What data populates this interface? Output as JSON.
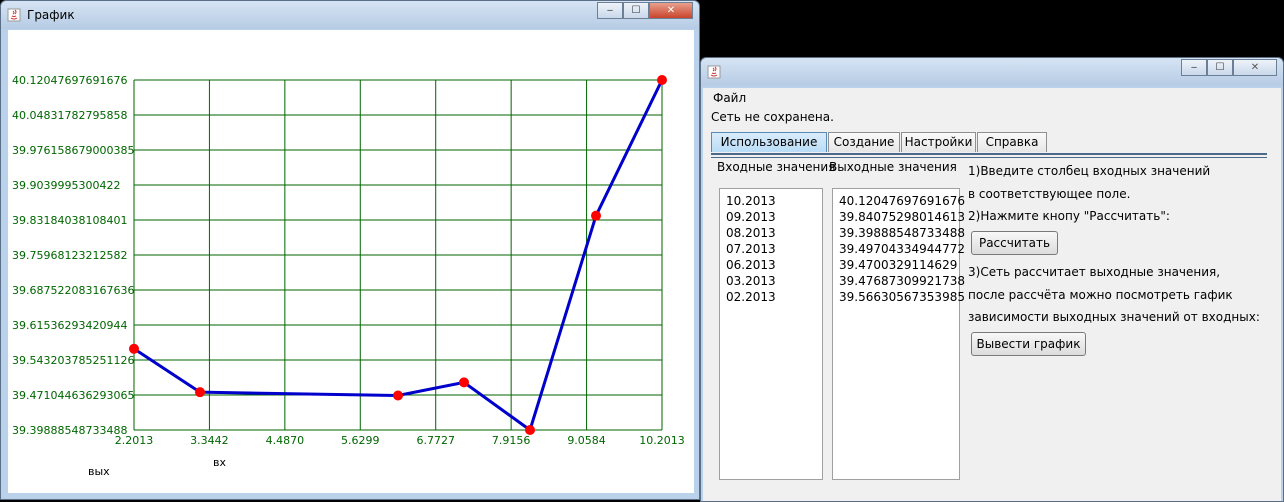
{
  "graph_window": {
    "title": "График",
    "chart_data": {
      "type": "line",
      "x_tick_labels": [
        "2.2013",
        "3.3442",
        "4.4870",
        "5.6299",
        "6.7727",
        "7.9156",
        "9.0584",
        "10.2013"
      ],
      "y_tick_labels": [
        "40.12047697691676",
        "40.04831782795858",
        "39.976158679000385",
        "39.9039995300422",
        "39.83184038108401",
        "39.75968123212582",
        "39.687522083167636",
        "39.61536293420944",
        "39.543203785251126",
        "39.471044636293065",
        "39.39888548733488"
      ],
      "x": [
        2.2013,
        3.2013,
        6.2013,
        7.2013,
        8.2013,
        9.2013,
        10.2013
      ],
      "y": [
        39.56630567353985,
        39.47687309921738,
        39.4700329114629,
        39.49704334944772,
        39.39888548733488,
        39.84075298014613,
        40.12047697691676
      ],
      "xlim": [
        2.2013,
        10.2013
      ],
      "ylim": [
        39.39888548733488,
        40.12047697691676
      ],
      "xlabel": "вх",
      "ylabel": "вых",
      "grid": true,
      "colors": {
        "line": "#0000cc",
        "point": "#ff0000",
        "grid": "#006600",
        "ticks": "#006600"
      }
    }
  },
  "main_window": {
    "title": "",
    "menu": {
      "file": "Файл"
    },
    "status": "Сеть не сохранена.",
    "tabs": [
      "Использование",
      "Создание",
      "Настройки",
      "Справка"
    ],
    "active_tab": 0,
    "input_label": "Входные значения",
    "output_label": "Выходные значения",
    "inputs": [
      "10.2013",
      "09.2013",
      "08.2013",
      "07.2013",
      "06.2013",
      "03.2013",
      "02.2013"
    ],
    "outputs": [
      "40.12047697691676",
      "39.84075298014613",
      "39.39888548733488",
      "39.49704334944772",
      "39.4700329114629",
      "39.47687309921738",
      "39.56630567353985"
    ],
    "instructions": {
      "step1a": "1)Введите столбец входных значений",
      "step1b": "в соответствующее поле.",
      "step2": "2)Нажмите кнопу \"Рассчитать\":",
      "step3a": "3)Сеть рассчитает выходные значения,",
      "step3b": "после рассчёта можно посмотреть гафик",
      "step3c": "зависимости выходных значений от входных:"
    },
    "calc_button": "Рассчитать",
    "plot_button": "Вывести график"
  },
  "window_buttons": {
    "minimize": "‒",
    "maximize": "☐",
    "close": "✕"
  }
}
